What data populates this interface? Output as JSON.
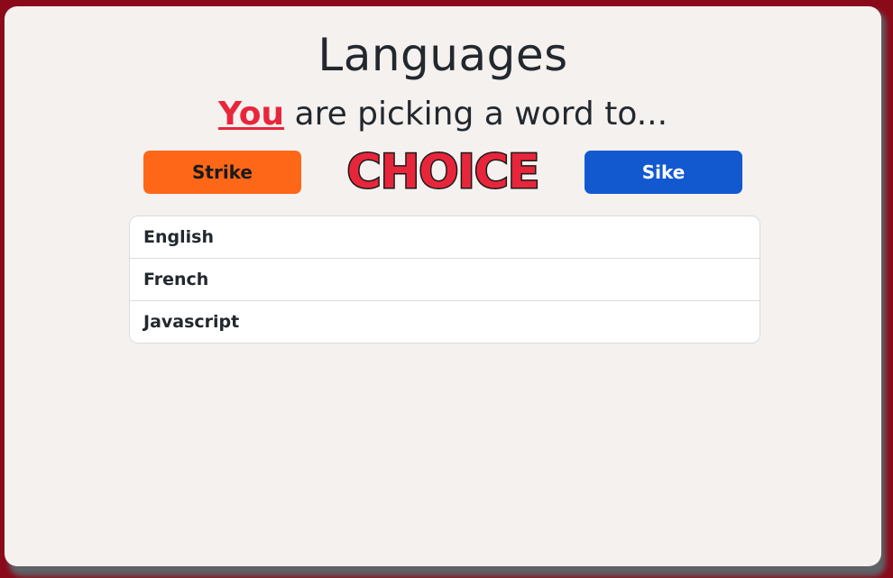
{
  "title": "Languages",
  "subtitle": {
    "highlight": "You",
    "rest": " are picking a word to..."
  },
  "buttons": {
    "strike_label": "Strike",
    "sike_label": "Sike"
  },
  "choice_label": "CHOICE",
  "list": {
    "items": [
      {
        "label": "English"
      },
      {
        "label": "French"
      },
      {
        "label": "Javascript"
      }
    ]
  },
  "colors": {
    "background": "#8a0a1a",
    "card": "#f5f1ef",
    "accent_red": "#e8263b",
    "strike_orange": "#fe6717",
    "sike_blue": "#1259d0",
    "text_dark": "#22282e"
  }
}
